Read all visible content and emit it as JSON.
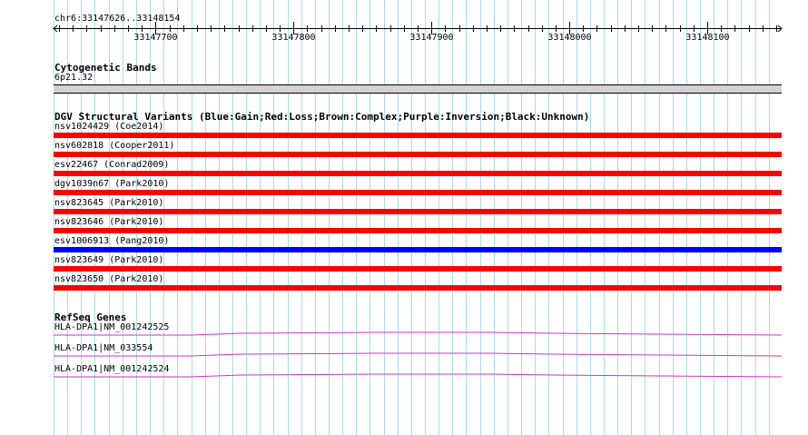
{
  "ruler": {
    "range_label": "chr6:33147626..33148154",
    "ticks": [
      {
        "label": "33147700",
        "pos": 33147700
      },
      {
        "label": "33147800",
        "pos": 33147800
      },
      {
        "label": "33147900",
        "pos": 33147900
      },
      {
        "label": "33148000",
        "pos": 33148000
      },
      {
        "label": "33148100",
        "pos": 33148100
      }
    ]
  },
  "cytobands": {
    "title": "Cytogenetic Bands",
    "band_label": "6p21.32"
  },
  "dgv": {
    "title": "DGV Structural Variants (Blue:Gain;Red:Loss;Brown:Complex;Purple:Inversion;Black:Unknown)",
    "variants": [
      {
        "label": "nsv1024429 (Coe2014)",
        "type": "loss",
        "color": "#ff0000"
      },
      {
        "label": "nsv602818 (Cooper2011)",
        "type": "loss",
        "color": "#ff0000"
      },
      {
        "label": "esv22467 (Conrad2009)",
        "type": "loss",
        "color": "#ff0000"
      },
      {
        "label": "dgv1039n67 (Park2010)",
        "type": "loss",
        "color": "#ff0000"
      },
      {
        "label": "nsv823645 (Park2010)",
        "type": "loss",
        "color": "#ff0000"
      },
      {
        "label": "nsv823646 (Park2010)",
        "type": "loss",
        "color": "#ff0000"
      },
      {
        "label": "esv1006913 (Pang2010)",
        "type": "gain",
        "color": "#0000ff"
      },
      {
        "label": "nsv823649 (Park2010)",
        "type": "loss",
        "color": "#ff0000"
      },
      {
        "label": "nsv823650 (Park2010)",
        "type": "loss",
        "color": "#ff0000"
      }
    ]
  },
  "refseq": {
    "title": "RefSeq Genes",
    "gene_color": "#cc33cc",
    "genes": [
      {
        "label": "HLA-DPA1|NM_001242525"
      },
      {
        "label": "HLA-DPA1|NM_033554"
      },
      {
        "label": "HLA-DPA1|NM_001242524"
      }
    ]
  },
  "colors": {
    "grid": "#aadddd",
    "band_fill": "#d3d3d3"
  }
}
